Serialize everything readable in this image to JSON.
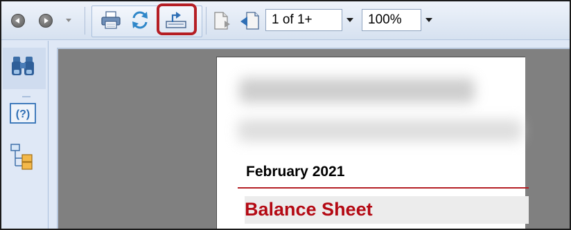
{
  "toolbar": {
    "page_field": "1 of 1+",
    "zoom_field": "100%"
  },
  "report": {
    "period": "February 2021",
    "title": "Balance Sheet"
  },
  "icons": {
    "back": "back-arrow-icon",
    "forward": "forward-arrow-icon",
    "print": "printer-icon",
    "refresh": "refresh-icon",
    "export": "export-icon",
    "page": "page-icon",
    "page_nav": "page-navigate-icon",
    "find": "binoculars-icon",
    "help": "help-icon",
    "document_map": "document-map-icon"
  },
  "colors": {
    "highlight": "#b51e24",
    "title": "#b40a14",
    "toolbar": "#dfe8f6",
    "viewer_background": "#808080"
  }
}
